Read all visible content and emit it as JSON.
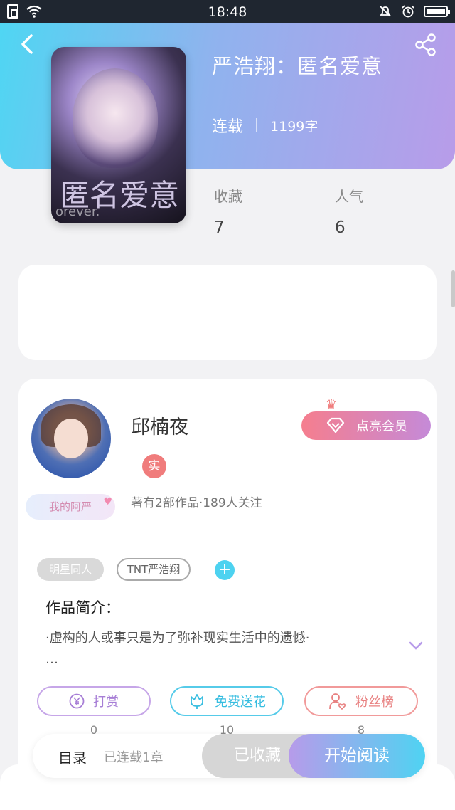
{
  "status_bar": {
    "time": "18:48"
  },
  "book": {
    "title": "严浩翔：匿名爱意",
    "status": "连载",
    "word_count": "1199字",
    "cover_text": "匿名爱意",
    "cover_sub": "orever."
  },
  "stats": {
    "favorites_label": "收藏",
    "favorites_value": "7",
    "popularity_label": "人气",
    "popularity_value": "6"
  },
  "author": {
    "name": "邱楠夜",
    "verified_badge": "实",
    "badge_label": "我的阿严",
    "info": "著有2部作品·189人关注",
    "vip_button": "点亮会员"
  },
  "tags": [
    "明星同人",
    "TNT严浩翔"
  ],
  "intro": {
    "title": "作品简介：",
    "text": "·虚构的人或事只是为了弥补现实生活中的遗憾·",
    "ellipsis": "…"
  },
  "actions": {
    "reward_label": "打赏",
    "reward_count": "0",
    "flower_label": "免费送花",
    "flower_count": "10",
    "fans_label": "粉丝榜",
    "fans_count": "8"
  },
  "bottom_bar": {
    "toc_label": "目录",
    "toc_info": "已连载1章",
    "collected_label": "已收藏",
    "read_label": "开始阅读"
  },
  "colors": {
    "header_gradient_start": "#4fd6f3",
    "header_gradient_end": "#b89ce9",
    "accent_cyan": "#4dd2f0",
    "accent_purple": "#b79bea",
    "vip_pink": "#f57e8e"
  }
}
